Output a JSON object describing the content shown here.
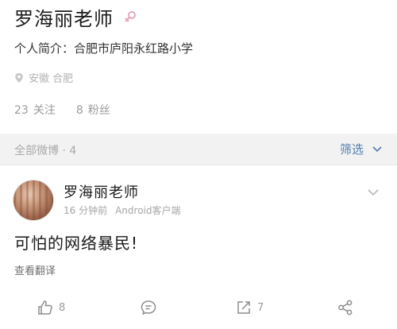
{
  "profile": {
    "name": "罗海丽老师",
    "bio": "个人简介：合肥市庐阳永红路小学",
    "location": "安徽 合肥",
    "following_count": "23",
    "following_label": "关注",
    "followers_count": "8",
    "followers_label": "粉丝"
  },
  "section": {
    "title": "全部微博 · 4",
    "filter_label": "筛选"
  },
  "post": {
    "author": "罗海丽老师",
    "time": "16 分钟前",
    "source": "Android客户端",
    "text": "可怕的网络暴民!",
    "translate_label": "查看翻译",
    "like_count": "8",
    "repost_count": "7"
  },
  "colors": {
    "accent": "#507daf",
    "muted": "#a9a9a9",
    "gender_icon": "#e8a6b8"
  },
  "icons": [
    "female-gender-icon",
    "location-pin-icon",
    "chevron-down-icon",
    "thumbs-up-icon",
    "comment-icon",
    "repost-icon",
    "share-icon"
  ]
}
